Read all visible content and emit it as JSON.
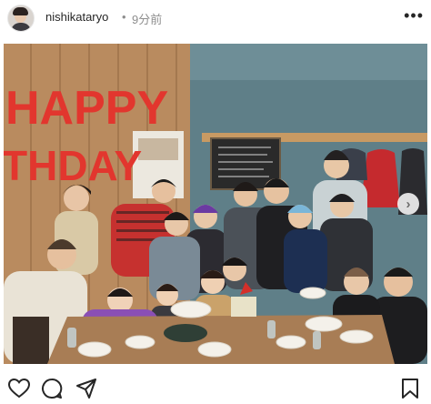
{
  "header": {
    "username": "nishikataryo",
    "separator": "•",
    "timestamp": "9分前",
    "more_label": "•••"
  },
  "photo": {
    "balloon_line1": "HAPPY",
    "balloon_line2": "THDAY",
    "balloon_color": "#e2362e"
  },
  "actions": {
    "like": "heart-icon",
    "comment": "comment-icon",
    "share": "send-icon",
    "save": "bookmark-icon",
    "next": "chevron-right-icon",
    "next_label": "›"
  }
}
